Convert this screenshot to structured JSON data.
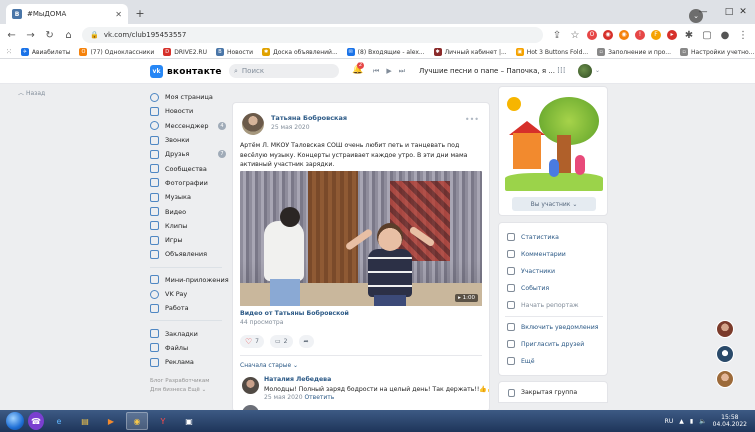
{
  "browser": {
    "tab_title": "#МыДОМА",
    "url": "vk.com/club195453557",
    "bookmarks": [
      {
        "label": "Авиабилеты",
        "color": "#1a73e8",
        "glyph": "✈"
      },
      {
        "label": "(77) Одноклассники",
        "color": "#f5820b",
        "glyph": "О"
      },
      {
        "label": "DRIVE2.RU",
        "color": "#d6302a",
        "glyph": "D"
      },
      {
        "label": "Новости",
        "color": "#4a76a8",
        "glyph": "В"
      },
      {
        "label": "Доска объявлений...",
        "color": "#e0a200",
        "glyph": "✱"
      },
      {
        "label": "(8) Входящие - alex...",
        "color": "#1a73e8",
        "glyph": "✉"
      },
      {
        "label": "Личный кабинет |...",
        "color": "#8a2a2a",
        "glyph": "✱"
      },
      {
        "label": "Hot 3 Buttons Fold...",
        "color": "#f5a200",
        "glyph": "▣"
      },
      {
        "label": "Заполнение и про...",
        "color": "#888888",
        "glyph": "▫"
      },
      {
        "label": "Настройки учетно...",
        "color": "#888888",
        "glyph": "▫"
      },
      {
        "label": "Руководство по эк...",
        "color": "#555555",
        "glyph": "◎"
      }
    ]
  },
  "vk": {
    "logo_text": "вконтакте",
    "logo_mark": "vk",
    "search_placeholder": "Поиск",
    "notification_count": "2",
    "now_playing": "Лучшие песни о папе – Папочка, я ...",
    "back_label": "Назад"
  },
  "menu": {
    "items": [
      {
        "label": "Моя страница",
        "icon": "user-circle-icon",
        "round": true
      },
      {
        "label": "Новости",
        "icon": "news-icon",
        "round": false
      },
      {
        "label": "Мессенджер",
        "icon": "message-icon",
        "round": true,
        "count": "4"
      },
      {
        "label": "Звонки",
        "icon": "phone-icon",
        "round": false
      },
      {
        "label": "Друзья",
        "icon": "friends-icon",
        "round": false,
        "count": "7"
      },
      {
        "label": "Сообщества",
        "icon": "communities-icon",
        "round": false
      },
      {
        "label": "Фотографии",
        "icon": "photo-icon",
        "round": false
      },
      {
        "label": "Музыка",
        "icon": "music-icon",
        "round": false
      },
      {
        "label": "Видео",
        "icon": "video-icon",
        "round": false
      },
      {
        "label": "Клипы",
        "icon": "clips-icon",
        "round": false
      },
      {
        "label": "Игры",
        "icon": "games-icon",
        "round": false
      },
      {
        "label": "Объявления",
        "icon": "ads-icon",
        "round": false
      }
    ],
    "items2": [
      {
        "label": "Мини-приложения",
        "icon": "mini-apps-icon",
        "round": false
      },
      {
        "label": "VK Pay",
        "icon": "vkpay-icon",
        "round": true
      },
      {
        "label": "Работа",
        "icon": "work-icon",
        "round": false
      }
    ],
    "items3": [
      {
        "label": "Закладки",
        "icon": "star-icon",
        "round": false
      },
      {
        "label": "Файлы",
        "icon": "file-icon",
        "round": false
      },
      {
        "label": "Реклама",
        "icon": "megaphone-icon",
        "round": false
      }
    ],
    "footer_line1": "Блог  Разработчикам",
    "footer_line2": "Для бизнеса  Ещё ⌄"
  },
  "post": {
    "author": "Татьяна Бобровская",
    "date": "25 мая 2020",
    "text": "Артём Л. МКОУ Таловская СОШ очень любит петь и танцевать под весёлую музыку. Концерты устраивает каждое утро. В эти дни мама активный участник зарядки.",
    "video_duration": "1:00",
    "video_title": "Видео от Татьяны Бобровской",
    "views": "44 просмотра",
    "likes": "7",
    "comments": "2",
    "sort_label": "Сначала старые ⌄",
    "comment": {
      "name": "Наталия Лебедева",
      "text": "Молодцы! Полный заряд бодрости на целый день! Так держать!!👍👍👍",
      "date": "25 мая 2020",
      "reply": "Ответить"
    }
  },
  "right": {
    "member_button": "Вы участник ⌄",
    "links": [
      {
        "label": "Статистика",
        "icon": "stats-icon"
      },
      {
        "label": "Комментарии",
        "icon": "comment-icon"
      },
      {
        "label": "Участники",
        "icon": "members-icon"
      },
      {
        "label": "События",
        "icon": "calendar-icon"
      },
      {
        "label": "Начать репортаж",
        "icon": "broadcast-icon",
        "muted": true
      },
      {
        "label": "Включить уведомления",
        "icon": "bell-icon"
      },
      {
        "label": "Пригласить друзей",
        "icon": "invite-icon"
      },
      {
        "label": "Ещё",
        "icon": "chevron-down-icon"
      }
    ],
    "closed_group": "Закрытая группа"
  },
  "taskbar": {
    "lang": "RU",
    "time": "15:58",
    "date": "04.04.2022"
  }
}
